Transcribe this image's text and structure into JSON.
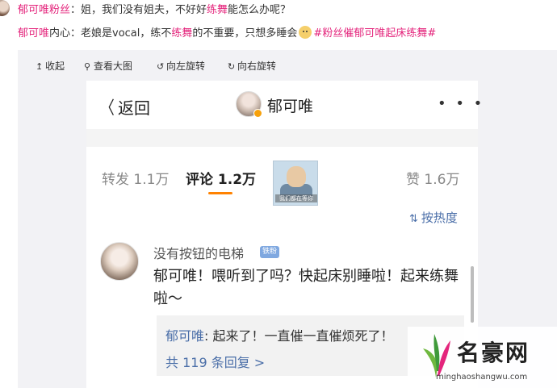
{
  "post": {
    "line1_user": "郁可唯粉丝",
    "line1_text_a": "：姐，我们没有姐夫，不好好",
    "line1_highlight": "练舞",
    "line1_text_b": "能怎么办呢？",
    "line2_user": "郁可唯",
    "line2_text_a": "内心：老娘是vocal，练不",
    "line2_highlight": "练舞",
    "line2_text_b": "的不重要，只想多睡会",
    "line2_tag": "#粉丝催郁可唯起床练舞#"
  },
  "toolbar": {
    "collapse": "收起",
    "view_large": "查看大图",
    "rotate_left": "向左旋转",
    "rotate_right": "向右旋转"
  },
  "phone": {
    "back_label": "返回",
    "title": "郁可唯",
    "more_label": "• • •",
    "tabs": {
      "repost": "转发 1.1万",
      "comments": "评论 1.2万",
      "likes": "赞 1.6万"
    },
    "sticker_caption": "我们都在等你",
    "sort_label": "按热度",
    "comment": {
      "user": "没有按钮的电梯",
      "badge": "铁粉",
      "text": "郁可唯！喂听到了吗？快起床别睡啦！起来练舞啦～",
      "reply_user": "郁可唯",
      "reply_text": ": 起来了！一直催一直催烦死了！",
      "reply_more": "共 119 条回复 >"
    }
  },
  "watermark": {
    "title": "名豪网",
    "url": "minghaoshangwu.com"
  },
  "colors": {
    "accent_pink": "#e4257c",
    "link_blue": "#4a6ea8",
    "tab_orange": "#ff8200"
  }
}
